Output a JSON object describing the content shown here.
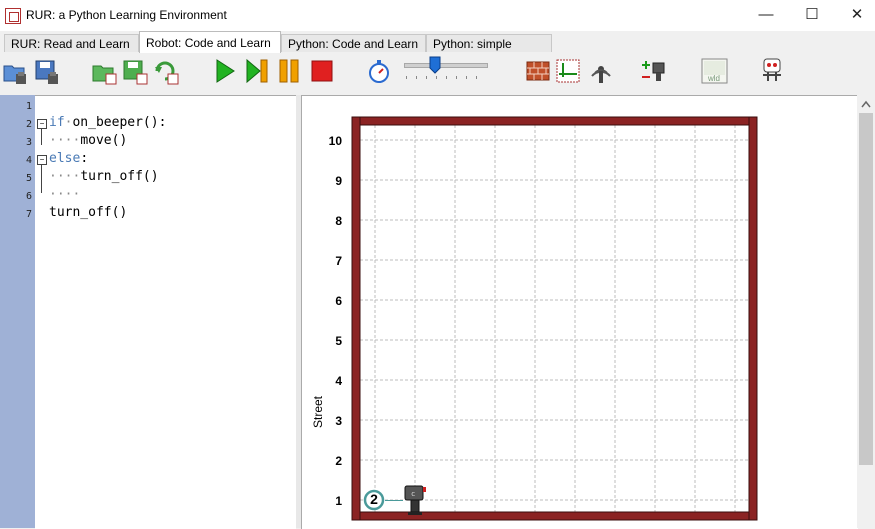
{
  "window": {
    "title": "RUR: a Python Learning Environment",
    "minimize": "—",
    "maximize": "☐",
    "close": "✕"
  },
  "tabs": [
    {
      "label": "RUR: Read and Learn"
    },
    {
      "label": "Robot: Code and Learn"
    },
    {
      "label": "Python: Code and Learn"
    },
    {
      "label": "Python: simple editor"
    }
  ],
  "toolbar": {
    "world_file_label": "wld",
    "speed_slider_fraction": 0.4
  },
  "editor": {
    "line_numbers": [
      "1",
      "2",
      "3",
      "4",
      "5",
      "6",
      "7"
    ],
    "lines": {
      "l2_kw": "if",
      "l2_dot": "·",
      "l2_rest": "on_beeper():",
      "l3_dots": "····",
      "l3_rest": "move()",
      "l4_kw": "else",
      "l4_rest": ":",
      "l5_dots": "····",
      "l5_rest": "turn_off()",
      "l6_dots": "····",
      "l7_rest": "turn_off()"
    }
  },
  "world": {
    "street_label": "Street",
    "y_labels": [
      "10",
      "9",
      "8",
      "7",
      "6",
      "5",
      "4",
      "3",
      "2",
      "1"
    ],
    "beeper_count": "2",
    "wall_color": "#8b2323",
    "grid_color": "#bdbdbd"
  }
}
